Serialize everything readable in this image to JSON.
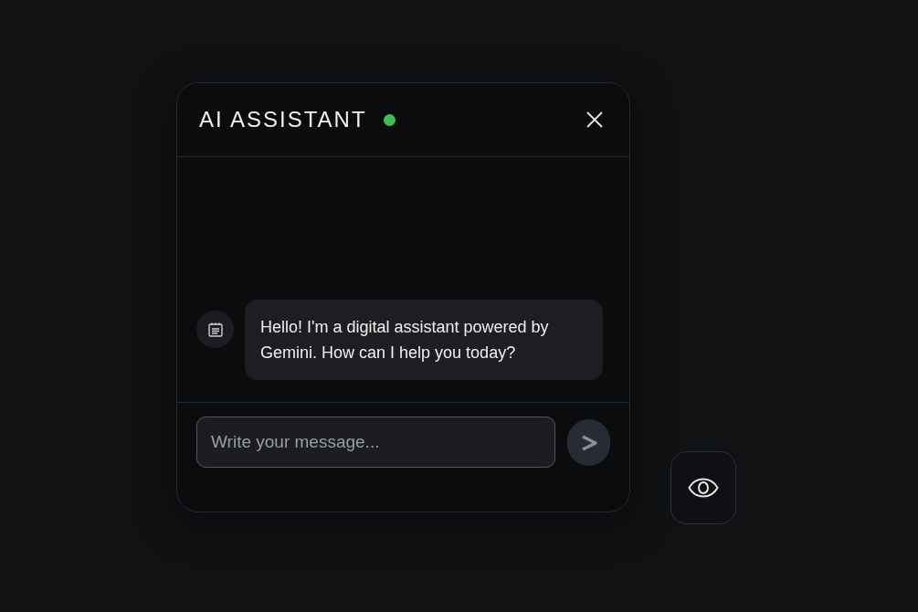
{
  "chat": {
    "title": "AI ASSISTANT",
    "status": {
      "color": "#3fbf4a"
    },
    "messages": [
      {
        "text": "Hello! I'm a digital assistant powered by Gemini. How can I help you today?"
      }
    ],
    "input": {
      "placeholder": "Write your message..."
    }
  }
}
